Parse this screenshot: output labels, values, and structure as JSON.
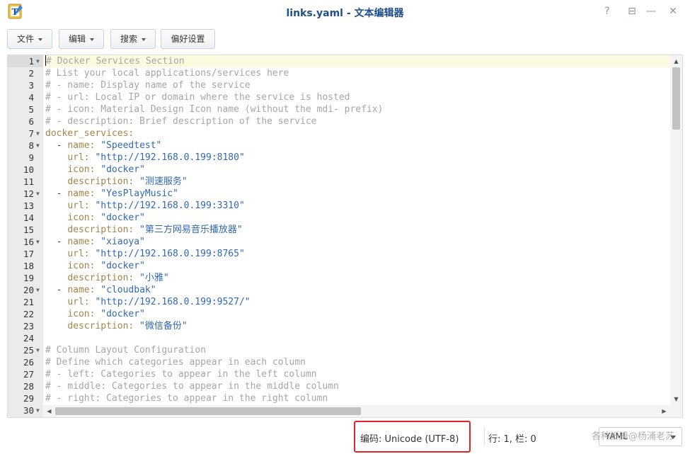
{
  "window": {
    "title": "links.yaml - 文本编辑器"
  },
  "controls": {
    "help": "?",
    "pin": "⊟",
    "minimize": "—",
    "maximize": "□",
    "close": "✕"
  },
  "toolbar": {
    "file": "文件",
    "edit": "编辑",
    "search": "搜索",
    "prefs": "偏好设置"
  },
  "editor": {
    "lines": [
      {
        "n": "1",
        "fold": true,
        "tokens": [
          [
            "cursor",
            ""
          ],
          [
            "c-comment",
            "# Docker Services Section"
          ]
        ]
      },
      {
        "n": "2",
        "fold": false,
        "tokens": [
          [
            "c-comment",
            "# List your local applications/services here"
          ]
        ]
      },
      {
        "n": "3",
        "fold": false,
        "tokens": [
          [
            "c-comment",
            "# - name: Display name of the service"
          ]
        ]
      },
      {
        "n": "4",
        "fold": false,
        "tokens": [
          [
            "c-comment",
            "# - url: Local IP or domain where the service is hosted"
          ]
        ]
      },
      {
        "n": "5",
        "fold": false,
        "tokens": [
          [
            "c-comment",
            "# - icon: Material Design Icon name (without the mdi- prefix)"
          ]
        ]
      },
      {
        "n": "6",
        "fold": false,
        "tokens": [
          [
            "c-comment",
            "# - description: Brief description of the service"
          ]
        ]
      },
      {
        "n": "7",
        "fold": true,
        "tokens": [
          [
            "c-key",
            "docker_services:"
          ]
        ]
      },
      {
        "n": "8",
        "fold": true,
        "tokens": [
          [
            "c-plain",
            "  - "
          ],
          [
            "c-key",
            "name: "
          ],
          [
            "c-str",
            "\"Speedtest\""
          ]
        ]
      },
      {
        "n": "9",
        "fold": false,
        "tokens": [
          [
            "c-plain",
            "    "
          ],
          [
            "c-key",
            "url: "
          ],
          [
            "c-str",
            "\"http://192.168.0.199:8180\""
          ]
        ]
      },
      {
        "n": "10",
        "fold": false,
        "tokens": [
          [
            "c-plain",
            "    "
          ],
          [
            "c-key",
            "icon: "
          ],
          [
            "c-str",
            "\"docker\""
          ]
        ]
      },
      {
        "n": "11",
        "fold": false,
        "tokens": [
          [
            "c-plain",
            "    "
          ],
          [
            "c-key",
            "description: "
          ],
          [
            "c-str",
            "\"测速服务\""
          ]
        ]
      },
      {
        "n": "12",
        "fold": true,
        "tokens": [
          [
            "c-plain",
            "  - "
          ],
          [
            "c-key",
            "name: "
          ],
          [
            "c-str",
            "\"YesPlayMusic\""
          ]
        ]
      },
      {
        "n": "13",
        "fold": false,
        "tokens": [
          [
            "c-plain",
            "    "
          ],
          [
            "c-key",
            "url: "
          ],
          [
            "c-str",
            "\"http://192.168.0.199:3310\""
          ]
        ]
      },
      {
        "n": "14",
        "fold": false,
        "tokens": [
          [
            "c-plain",
            "    "
          ],
          [
            "c-key",
            "icon: "
          ],
          [
            "c-str",
            "\"docker\""
          ]
        ]
      },
      {
        "n": "15",
        "fold": false,
        "tokens": [
          [
            "c-plain",
            "    "
          ],
          [
            "c-key",
            "description: "
          ],
          [
            "c-str",
            "\"第三方网易音乐播放器\""
          ]
        ]
      },
      {
        "n": "16",
        "fold": true,
        "tokens": [
          [
            "c-plain",
            "  - "
          ],
          [
            "c-key",
            "name: "
          ],
          [
            "c-str",
            "\"xiaoya\""
          ]
        ]
      },
      {
        "n": "17",
        "fold": false,
        "tokens": [
          [
            "c-plain",
            "    "
          ],
          [
            "c-key",
            "url: "
          ],
          [
            "c-str",
            "\"http://192.168.0.199:8765\""
          ]
        ]
      },
      {
        "n": "18",
        "fold": false,
        "tokens": [
          [
            "c-plain",
            "    "
          ],
          [
            "c-key",
            "icon: "
          ],
          [
            "c-str",
            "\"docker\""
          ]
        ]
      },
      {
        "n": "19",
        "fold": false,
        "tokens": [
          [
            "c-plain",
            "    "
          ],
          [
            "c-key",
            "description: "
          ],
          [
            "c-str",
            "\"小雅\""
          ]
        ]
      },
      {
        "n": "20",
        "fold": true,
        "tokens": [
          [
            "c-plain",
            "  - "
          ],
          [
            "c-key",
            "name: "
          ],
          [
            "c-str",
            "\"cloudbak\""
          ]
        ]
      },
      {
        "n": "21",
        "fold": false,
        "tokens": [
          [
            "c-plain",
            "    "
          ],
          [
            "c-key",
            "url: "
          ],
          [
            "c-str",
            "\"http://192.168.0.199:9527/\""
          ]
        ]
      },
      {
        "n": "22",
        "fold": false,
        "tokens": [
          [
            "c-plain",
            "    "
          ],
          [
            "c-key",
            "icon: "
          ],
          [
            "c-str",
            "\"docker\""
          ]
        ]
      },
      {
        "n": "23",
        "fold": false,
        "tokens": [
          [
            "c-plain",
            "    "
          ],
          [
            "c-key",
            "description: "
          ],
          [
            "c-str",
            "\"微信备份\""
          ]
        ]
      },
      {
        "n": "24",
        "fold": false,
        "tokens": []
      },
      {
        "n": "25",
        "fold": true,
        "tokens": [
          [
            "c-comment",
            "# Column Layout Configuration"
          ]
        ]
      },
      {
        "n": "26",
        "fold": false,
        "tokens": [
          [
            "c-comment",
            "# Define which categories appear in each column"
          ]
        ]
      },
      {
        "n": "27",
        "fold": false,
        "tokens": [
          [
            "c-comment",
            "# - left: Categories to appear in the left column"
          ]
        ]
      },
      {
        "n": "28",
        "fold": false,
        "tokens": [
          [
            "c-comment",
            "# - middle: Categories to appear in the middle column"
          ]
        ]
      },
      {
        "n": "29",
        "fold": false,
        "tokens": [
          [
            "c-comment",
            "# - right: Categories to appear in the right column"
          ]
        ]
      },
      {
        "n": "30",
        "fold": true,
        "tokens": []
      }
    ]
  },
  "status": {
    "encoding": "编码: Unicode (UTF-8)",
    "position": "行: 1, 栏: 0",
    "language": "YAML",
    "watermark": "各种折腾@杨浦老苏"
  },
  "colors": {
    "title": "#1e4f8c",
    "comment": "#a6a6a6",
    "key": "#a2854b",
    "string": "#3168b3",
    "highlight_box": "#e0242b"
  }
}
